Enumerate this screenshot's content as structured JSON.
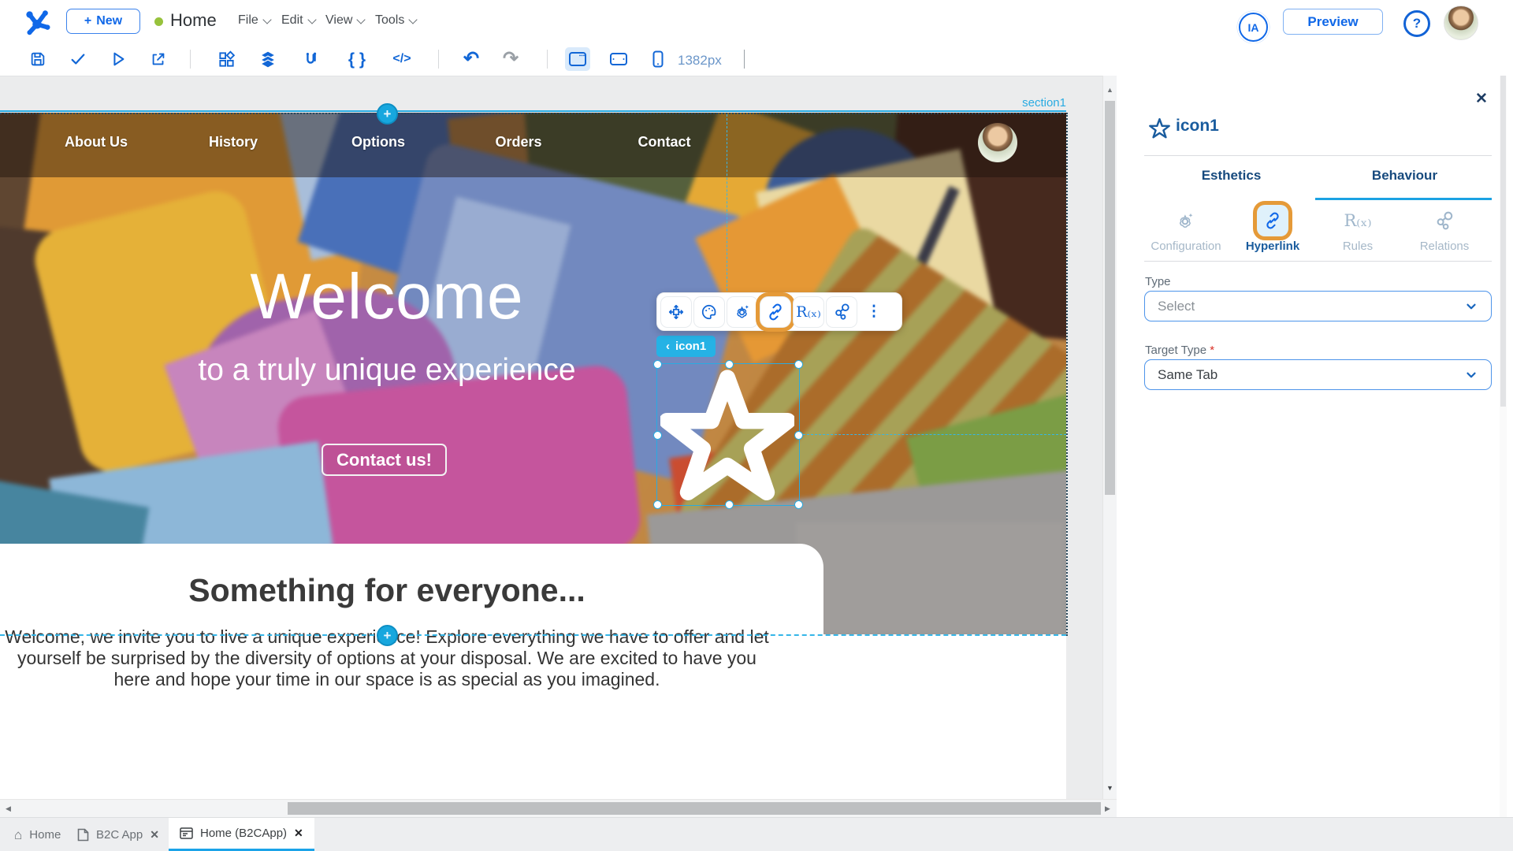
{
  "topbar": {
    "new_label": "New",
    "doc_title": "Home",
    "menus": {
      "file": "File",
      "edit": "Edit",
      "view": "View",
      "tools": "Tools"
    },
    "ia_label": "IA",
    "preview_label": "Preview",
    "help_label": "?"
  },
  "toolbar": {
    "width_label": "1382px"
  },
  "glyphs": {
    "plus": "+",
    "close": "✕",
    "kebab": "⋮",
    "undo": "↶",
    "redo": "↷",
    "braces": "{ }",
    "code": "</>",
    "rules": "R₍ₓ₎",
    "back_chevron": "‹",
    "home": "⌂",
    "up_arrow": "▲",
    "down_arrow": "▼",
    "left_arrow": "◀",
    "right_arrow": "▶"
  },
  "canvas": {
    "section_label": "section1",
    "selected_widget": {
      "label": "icon1"
    },
    "nav": {
      "items": [
        "About Us",
        "History",
        "Options",
        "Orders",
        "Contact"
      ]
    },
    "hero": {
      "title": "Welcome",
      "subtitle": "to a truly unique experience",
      "cta_label": "Contact us!"
    },
    "content": {
      "heading": "Something for everyone...",
      "paragraph": "Welcome, we invite you to live a unique experience! Explore everything we have to offer and let yourself be surprised by the diversity of options at your disposal. We are excited to have you here and hope your time in our space is as special as you imagined."
    }
  },
  "panel": {
    "title": "icon1",
    "tabs": {
      "esthetics": "Esthetics",
      "behaviour": "Behaviour"
    },
    "subtabs": {
      "configuration": "Configuration",
      "hyperlink": "Hyperlink",
      "rules": "Rules",
      "relations": "Relations"
    },
    "fields": {
      "type": {
        "label": "Type",
        "value": "Select"
      },
      "target_type": {
        "label": "Target Type",
        "required_mark": "*",
        "value": "Same Tab"
      }
    }
  },
  "bottombar": {
    "tabs": {
      "home": {
        "label": "Home"
      },
      "b2c_app": {
        "label": "B2C App"
      },
      "home_b2capp": {
        "label": "Home (B2CApp)"
      }
    }
  },
  "colors": {
    "accent_blue": "#1068e8",
    "selection_cyan": "#29abe2",
    "annotation_orange": "#e59a38",
    "tab_underline": "#1ba2e3",
    "required_red": "#d93025",
    "status_green": "#97c23c"
  }
}
